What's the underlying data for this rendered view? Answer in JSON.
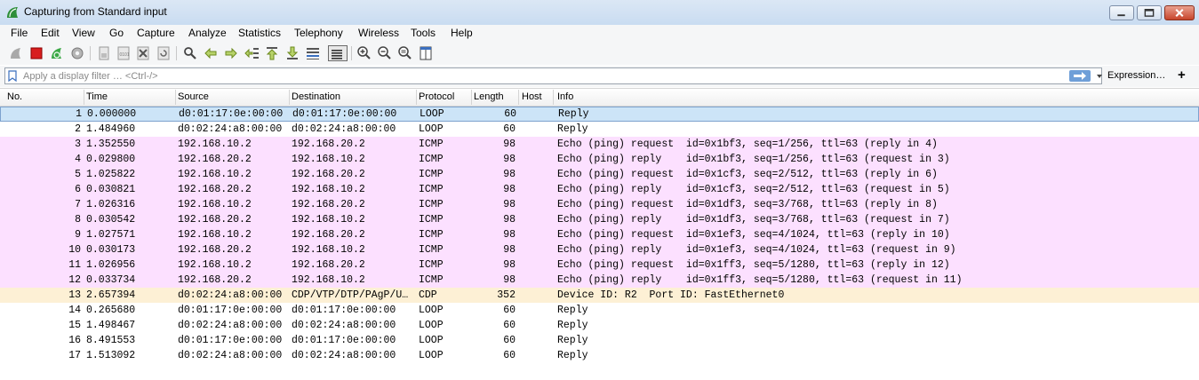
{
  "window": {
    "title": "Capturing from Standard input",
    "controls": [
      "minimize-icon",
      "maximize-icon",
      "close-icon"
    ]
  },
  "menubar": {
    "items": [
      "File",
      "Edit",
      "View",
      "Go",
      "Capture",
      "Analyze",
      "Statistics",
      "Telephony",
      "Wireless",
      "Tools",
      "Help"
    ]
  },
  "toolbar": {
    "icons": [
      "start-capture-icon",
      "stop-capture-icon",
      "restart-capture-icon",
      "capture-options-icon",
      "open-file-icon",
      "save-file-icon",
      "close-file-icon",
      "reload-file-icon",
      "find-packet-icon",
      "go-back-icon",
      "go-forward-icon",
      "go-to-packet-icon",
      "go-first-icon",
      "go-last-icon",
      "auto-scroll-icon",
      "colorize-icon",
      "zoom-in-icon",
      "zoom-out-icon",
      "normal-size-icon",
      "resize-columns-icon"
    ]
  },
  "filter": {
    "placeholder": "Apply a display filter … <Ctrl-/>",
    "expression_label": "Expression…",
    "add_label": "+"
  },
  "colors": {
    "selected_row": "#cce4f7",
    "icmp_row": "#fce0ff",
    "cdp_row": "#fdf0d5",
    "loop_row": "#ffffff"
  },
  "packet_list": {
    "columns": [
      "No.",
      "Time",
      "Source",
      "Destination",
      "Protocol",
      "Length",
      "Host",
      "Info"
    ],
    "rows": [
      {
        "no": "1",
        "time": "0.000000",
        "src": "d0:01:17:0e:00:00",
        "dst": "d0:01:17:0e:00:00",
        "proto": "LOOP",
        "len": "60",
        "info": "Reply",
        "kind": "selected"
      },
      {
        "no": "2",
        "time": "1.484960",
        "src": "d0:02:24:a8:00:00",
        "dst": "d0:02:24:a8:00:00",
        "proto": "LOOP",
        "len": "60",
        "info": "Reply",
        "kind": "loop"
      },
      {
        "no": "3",
        "time": "1.352550",
        "src": "192.168.10.2",
        "dst": "192.168.20.2",
        "proto": "ICMP",
        "len": "98",
        "info": "Echo (ping) request  id=0x1bf3, seq=1/256, ttl=63 (reply in 4)",
        "kind": "icmp"
      },
      {
        "no": "4",
        "time": "0.029800",
        "src": "192.168.20.2",
        "dst": "192.168.10.2",
        "proto": "ICMP",
        "len": "98",
        "info": "Echo (ping) reply    id=0x1bf3, seq=1/256, ttl=63 (request in 3)",
        "kind": "icmp"
      },
      {
        "no": "5",
        "time": "1.025822",
        "src": "192.168.10.2",
        "dst": "192.168.20.2",
        "proto": "ICMP",
        "len": "98",
        "info": "Echo (ping) request  id=0x1cf3, seq=2/512, ttl=63 (reply in 6)",
        "kind": "icmp"
      },
      {
        "no": "6",
        "time": "0.030821",
        "src": "192.168.20.2",
        "dst": "192.168.10.2",
        "proto": "ICMP",
        "len": "98",
        "info": "Echo (ping) reply    id=0x1cf3, seq=2/512, ttl=63 (request in 5)",
        "kind": "icmp"
      },
      {
        "no": "7",
        "time": "1.026316",
        "src": "192.168.10.2",
        "dst": "192.168.20.2",
        "proto": "ICMP",
        "len": "98",
        "info": "Echo (ping) request  id=0x1df3, seq=3/768, ttl=63 (reply in 8)",
        "kind": "icmp"
      },
      {
        "no": "8",
        "time": "0.030542",
        "src": "192.168.20.2",
        "dst": "192.168.10.2",
        "proto": "ICMP",
        "len": "98",
        "info": "Echo (ping) reply    id=0x1df3, seq=3/768, ttl=63 (request in 7)",
        "kind": "icmp"
      },
      {
        "no": "9",
        "time": "1.027571",
        "src": "192.168.10.2",
        "dst": "192.168.20.2",
        "proto": "ICMP",
        "len": "98",
        "info": "Echo (ping) request  id=0x1ef3, seq=4/1024, ttl=63 (reply in 10)",
        "kind": "icmp"
      },
      {
        "no": "10",
        "time": "0.030173",
        "src": "192.168.20.2",
        "dst": "192.168.10.2",
        "proto": "ICMP",
        "len": "98",
        "info": "Echo (ping) reply    id=0x1ef3, seq=4/1024, ttl=63 (request in 9)",
        "kind": "icmp"
      },
      {
        "no": "11",
        "time": "1.026956",
        "src": "192.168.10.2",
        "dst": "192.168.20.2",
        "proto": "ICMP",
        "len": "98",
        "info": "Echo (ping) request  id=0x1ff3, seq=5/1280, ttl=63 (reply in 12)",
        "kind": "icmp"
      },
      {
        "no": "12",
        "time": "0.033734",
        "src": "192.168.20.2",
        "dst": "192.168.10.2",
        "proto": "ICMP",
        "len": "98",
        "info": "Echo (ping) reply    id=0x1ff3, seq=5/1280, ttl=63 (request in 11)",
        "kind": "icmp"
      },
      {
        "no": "13",
        "time": "2.657394",
        "src": "d0:02:24:a8:00:00",
        "dst": "CDP/VTP/DTP/PAgP/U…",
        "proto": "CDP",
        "len": "352",
        "info": "Device ID: R2  Port ID: FastEthernet0",
        "kind": "cdp"
      },
      {
        "no": "14",
        "time": "0.265680",
        "src": "d0:01:17:0e:00:00",
        "dst": "d0:01:17:0e:00:00",
        "proto": "LOOP",
        "len": "60",
        "info": "Reply",
        "kind": "loop"
      },
      {
        "no": "15",
        "time": "1.498467",
        "src": "d0:02:24:a8:00:00",
        "dst": "d0:02:24:a8:00:00",
        "proto": "LOOP",
        "len": "60",
        "info": "Reply",
        "kind": "loop"
      },
      {
        "no": "16",
        "time": "8.491553",
        "src": "d0:01:17:0e:00:00",
        "dst": "d0:01:17:0e:00:00",
        "proto": "LOOP",
        "len": "60",
        "info": "Reply",
        "kind": "loop"
      },
      {
        "no": "17",
        "time": "1.513092",
        "src": "d0:02:24:a8:00:00",
        "dst": "d0:02:24:a8:00:00",
        "proto": "LOOP",
        "len": "60",
        "info": "Reply",
        "kind": "loop"
      }
    ]
  }
}
